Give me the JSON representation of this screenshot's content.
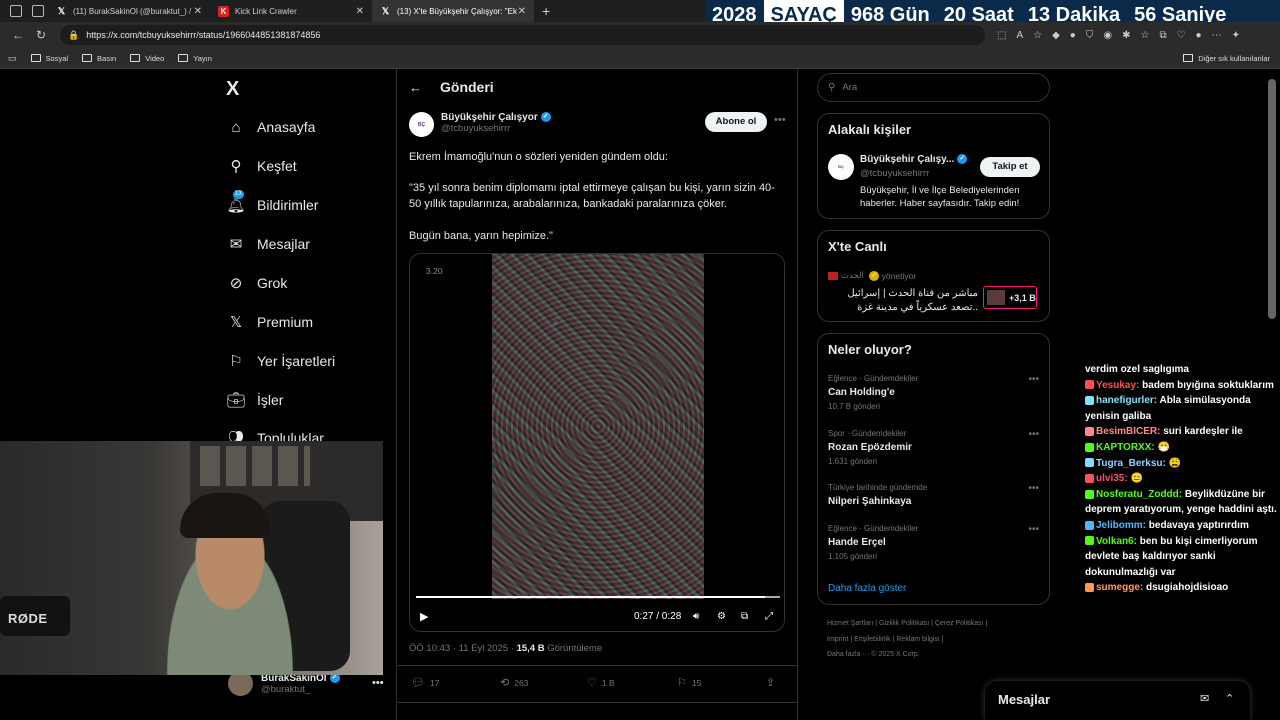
{
  "browser": {
    "tabs": [
      {
        "title": "(11) BurakSakinOl (@buraktut_) /",
        "favicon": "X"
      },
      {
        "title": "Kick Link Crawler",
        "favicon": "K"
      },
      {
        "title": "(13) X'te Büyükşehir Çalışyor: \"Ek",
        "favicon": "X"
      }
    ],
    "url": "https://x.com/tcbuyuksehirrr/status/1966044851381874856",
    "bookmarks": [
      "Sosyal",
      "Basın",
      "Video",
      "Yayın"
    ],
    "other_bookmarks": "Diğer sık kullanılanlar"
  },
  "countdown": {
    "year": "2028",
    "label": "SAYAÇ",
    "days": "968 Gün",
    "hours": "20 Saat",
    "minutes": "13 Dakika",
    "seconds": "56 Saniye"
  },
  "sidebar": {
    "logo": "X",
    "items": [
      {
        "label": "Anasayfa",
        "icon": "home-icon"
      },
      {
        "label": "Keşfet",
        "icon": "search-icon"
      },
      {
        "label": "Bildirimler",
        "icon": "bell-icon",
        "badge": "13"
      },
      {
        "label": "Mesajlar",
        "icon": "mail-icon"
      },
      {
        "label": "Grok",
        "icon": "grok-icon"
      },
      {
        "label": "Premium",
        "icon": "x-icon"
      },
      {
        "label": "Yer İşaretleri",
        "icon": "bookmark-icon"
      },
      {
        "label": "İşler",
        "icon": "briefcase-icon"
      },
      {
        "label": "Topluluklar",
        "icon": "people-icon"
      }
    ],
    "profile": {
      "name": "BurakSakinOl",
      "handle": "@buraktut_"
    }
  },
  "post": {
    "header_title": "Gönderi",
    "author_name": "Büyükşehir Çalışyor",
    "author_handle": "@tcbuyuksehirrr",
    "subscribe_label": "Abone ol",
    "text1": "Ekrem İmamoğlu'nun o sözleri yeniden gündem oldu:",
    "text2": "\"35 yıl sonra benim diplomamı iptal ettirmeye çalışan bu kişi, yarın sizin 40-50 yıllık tapularınıza, arabalarınıza, bankadaki paralarınıza çöker.",
    "text3": "Bugün bana, yarın hepimize.\"",
    "video": {
      "corner_time": "3.20",
      "time": "0:27 / 0:28",
      "progress": 0.96
    },
    "time": "ÖÖ 10:43 · 11 Eyl 2025 · ",
    "views": "15,4 B",
    "views_label": " Görüntüleme",
    "stats": {
      "replies": "17",
      "reposts": "263",
      "likes": "1 B",
      "bookmarks": "15"
    }
  },
  "right": {
    "search_placeholder": "Ara",
    "related_title": "Alakalı kişiler",
    "related": {
      "name": "Büyükşehir Çalışy...",
      "handle": "@tcbuyuksehirrr",
      "follow": "Takip et",
      "bio": "Büyükşehir, İl ve İlçe Belediyelerinden haberler. Haber sayfasıdır. Takip edin!"
    },
    "live_title": "X'te Canlı",
    "live": {
      "host": "الحدث",
      "status": "yönetiyor",
      "text": "مباشر من قناة الحدث | إسرائيل تصعد عسكرياً في مدينة غزة..",
      "count": "+3,1 B"
    },
    "trends_title": "Neler oluyor?",
    "trends": [
      {
        "context": "Eğlence · Gündemdekiler",
        "name": "Can Holding'e",
        "count": "10,7 B gönderi"
      },
      {
        "context": "Spor · Gündemdekiler",
        "name": "Rozan Epözdemir",
        "count": "1.631 gönderi"
      },
      {
        "context": "Türkiye tarihinde gündemde",
        "name": "Nilperi Şahinkaya",
        "count": ""
      },
      {
        "context": "Eğlence · Gündemdekiler",
        "name": "Hande Erçel",
        "count": "1.105 gönderi"
      }
    ],
    "show_more": "Daha fazla göster",
    "footer1": "Hizmet Şartları  |  Gizlilik Politikası  |  Çerez Politikası  |",
    "footer2": "Imprint  |  Erişilebilirlik  |  Reklam bilgisi  |",
    "footer3": "Daha fazla ···   © 2025 X Corp."
  },
  "messages_bar": "Mesajlar",
  "webcam_brand": "RØDE",
  "chat": [
    {
      "user": "",
      "text": "verdim ozel saglıgıma",
      "color": "#ffffff"
    },
    {
      "user": "Yesukay:",
      "text": " badem bıyığına soktuklarım",
      "color": "#ff4f4f"
    },
    {
      "user": "hanefigurler:",
      "text": " Abla simülasyonda yenisin galiba",
      "color": "#7fe3ff"
    },
    {
      "user": "BesimBICER:",
      "text": " suri kardeşler ile",
      "color": "#ff8a8a"
    },
    {
      "user": "KAPTORXX:",
      "text": " 😷",
      "color": "#53fc18"
    },
    {
      "user": "Tugra_Berksu:",
      "text": " 😩",
      "color": "#8fd3ff"
    },
    {
      "user": "ulvi35:",
      "text": " 😑",
      "color": "#ff4f6a"
    },
    {
      "user": "Nosferatu_Zoddd:",
      "text": " Beylikdüzüne bir deprem yaratıyorum, yenge haddini aştı.",
      "color": "#53fc18"
    },
    {
      "user": "Jelibomm:",
      "text": " bedavaya yaptırırdım",
      "color": "#4fb7ff"
    },
    {
      "user": "Volkan6:",
      "text": " ben bu kişi cimerliyorum devlete baş kaldırıyor sanki dokunulmazlığı var",
      "color": "#53fc18"
    },
    {
      "user": "sumegge:",
      "text": " dsugiahojdisioao",
      "color": "#ff9a4f"
    }
  ]
}
